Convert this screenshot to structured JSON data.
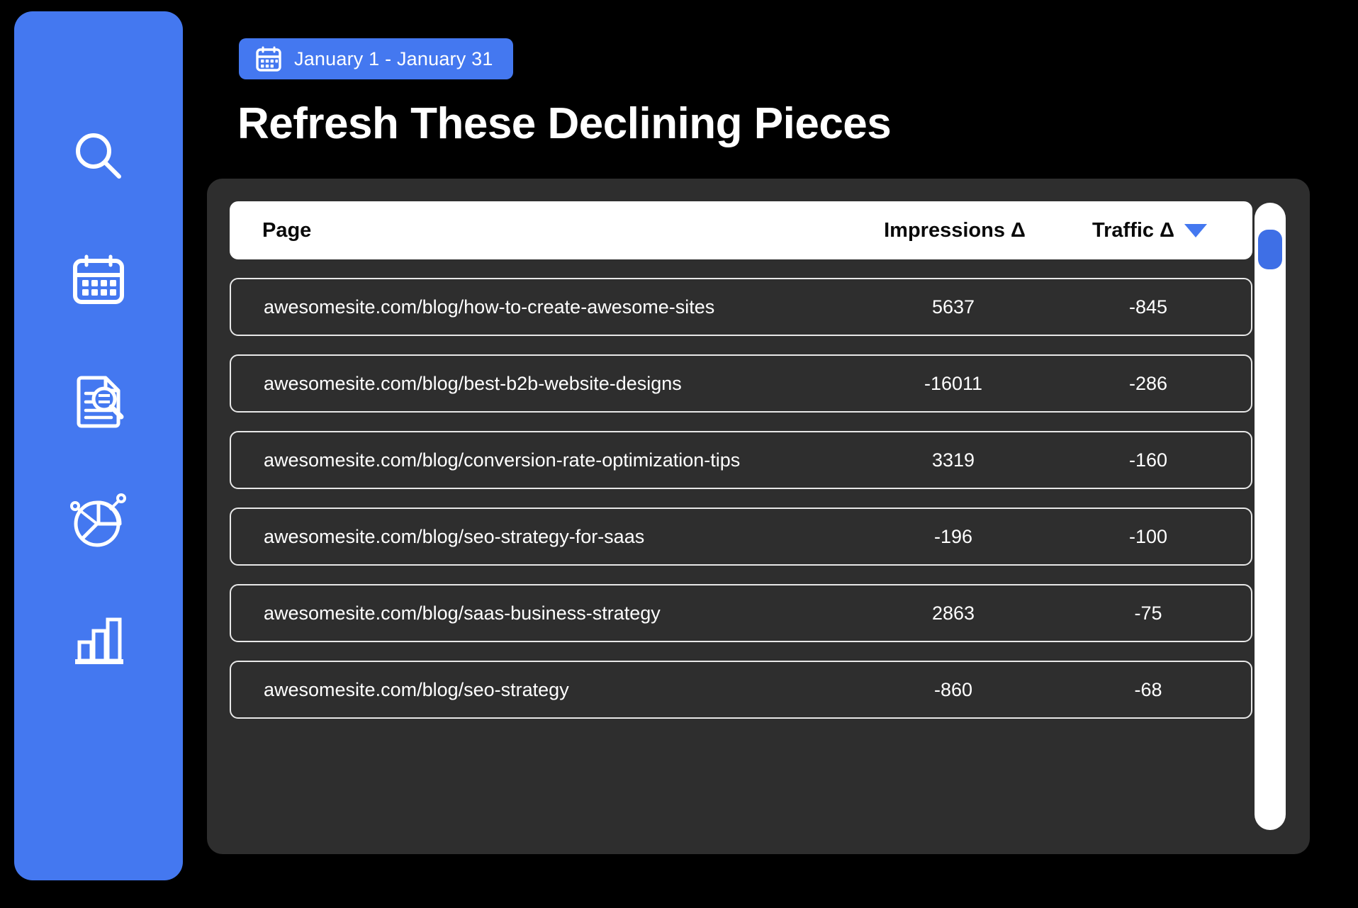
{
  "sidebar": {
    "items": [
      {
        "icon": "search-icon",
        "name": "search"
      },
      {
        "icon": "calendar-icon",
        "name": "calendar"
      },
      {
        "icon": "document-audit-icon",
        "name": "content-audit"
      },
      {
        "icon": "pie-chart-icon",
        "name": "analytics"
      },
      {
        "icon": "bar-chart-icon",
        "name": "reports"
      }
    ],
    "background_color": "#4478F0"
  },
  "header": {
    "date_range": "January 1 - January 31",
    "date_icon": "calendar-icon",
    "title": "Refresh These Declining Pieces"
  },
  "table": {
    "columns": {
      "page": "Page",
      "impressions": "Impressions Δ",
      "traffic": "Traffic Δ"
    },
    "sort": {
      "column": "traffic",
      "direction": "desc",
      "icon": "caret-down-icon",
      "color": "#4478F0"
    },
    "rows": [
      {
        "page": "awesomesite.com/blog/how-to-create-awesome-sites",
        "impressions": "5637",
        "traffic": "-845"
      },
      {
        "page": "awesomesite.com/blog/best-b2b-website-designs",
        "impressions": "-16011",
        "traffic": "-286"
      },
      {
        "page": "awesomesite.com/blog/conversion-rate-optimization-tips",
        "impressions": "3319",
        "traffic": "-160"
      },
      {
        "page": "awesomesite.com/blog/seo-strategy-for-saas",
        "impressions": "-196",
        "traffic": "-100"
      },
      {
        "page": "awesomesite.com/blog/saas-business-strategy",
        "impressions": "2863",
        "traffic": "-75"
      },
      {
        "page": "awesomesite.com/blog/seo-strategy",
        "impressions": "-860",
        "traffic": "-68"
      }
    ]
  },
  "scrollbar": {
    "track_color": "#ffffff",
    "thumb_color": "#3E6FE6",
    "position": "top"
  },
  "colors": {
    "background": "#000000",
    "card": "#2e2e2e",
    "accent": "#4478F0",
    "text_light": "#ffffff",
    "text_dark": "#0a0a0a"
  }
}
